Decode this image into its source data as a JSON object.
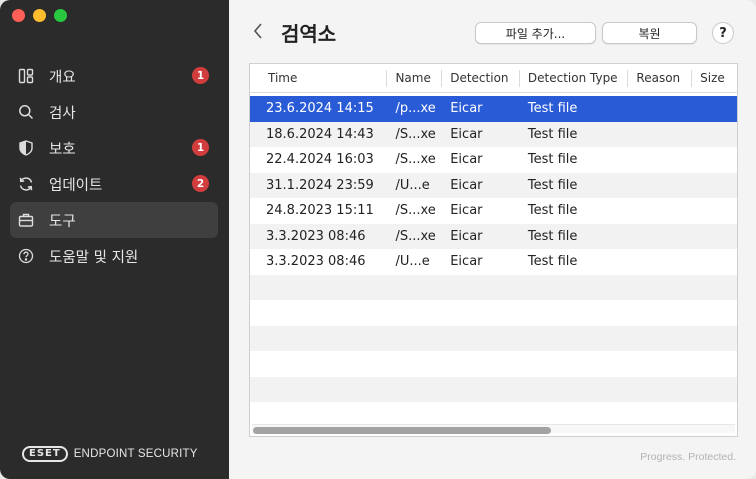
{
  "sidebar": {
    "items": [
      {
        "label": "개요",
        "icon": "overview-icon",
        "badge": "1",
        "active": false
      },
      {
        "label": "검사",
        "icon": "search-icon",
        "badge": "",
        "active": false
      },
      {
        "label": "보호",
        "icon": "shield-icon",
        "badge": "1",
        "active": false
      },
      {
        "label": "업데이트",
        "icon": "refresh-icon",
        "badge": "2",
        "active": false
      },
      {
        "label": "도구",
        "icon": "briefcase-icon",
        "badge": "",
        "active": true
      },
      {
        "label": "도움말 및 지원",
        "icon": "help-icon",
        "badge": "",
        "active": false
      }
    ],
    "brand_logo": "eset",
    "brand_text": "ENDPOINT SECURITY"
  },
  "main": {
    "title": "검역소",
    "add_file_button": "파일 추가...",
    "restore_button": "복원",
    "help_button": "?",
    "tagline": "Progress. Protected."
  },
  "table": {
    "columns": [
      "Time",
      "Name",
      "Detection",
      "Detection Type",
      "Reason",
      "Size"
    ],
    "rows": [
      {
        "time": "23.6.2024 14:15",
        "name": "/p...xe",
        "detection": "Eicar",
        "type": "Test file",
        "reason": "",
        "size": "",
        "selected": true
      },
      {
        "time": "18.6.2024 14:43",
        "name": "/S...xe",
        "detection": "Eicar",
        "type": "Test file",
        "reason": "",
        "size": "",
        "selected": false
      },
      {
        "time": "22.4.2024 16:03",
        "name": "/S...xe",
        "detection": "Eicar",
        "type": "Test file",
        "reason": "",
        "size": "",
        "selected": false
      },
      {
        "time": "31.1.2024 23:59",
        "name": "/U...e",
        "detection": "Eicar",
        "type": "Test file",
        "reason": "",
        "size": "",
        "selected": false
      },
      {
        "time": "24.8.2023 15:11",
        "name": "/S...xe",
        "detection": "Eicar",
        "type": "Test file",
        "reason": "",
        "size": "",
        "selected": false
      },
      {
        "time": "3.3.2023 08:46",
        "name": "/S...xe",
        "detection": "Eicar",
        "type": "Test file",
        "reason": "",
        "size": "",
        "selected": false
      },
      {
        "time": "3.3.2023 08:46",
        "name": "/U...e",
        "detection": "Eicar",
        "type": "Test file",
        "reason": "",
        "size": "",
        "selected": false
      }
    ],
    "empty_rows": 6
  },
  "colors": {
    "sidebar_bg": "#2b2b2b",
    "selection": "#2a5bd7",
    "badge": "#d13d3d"
  }
}
